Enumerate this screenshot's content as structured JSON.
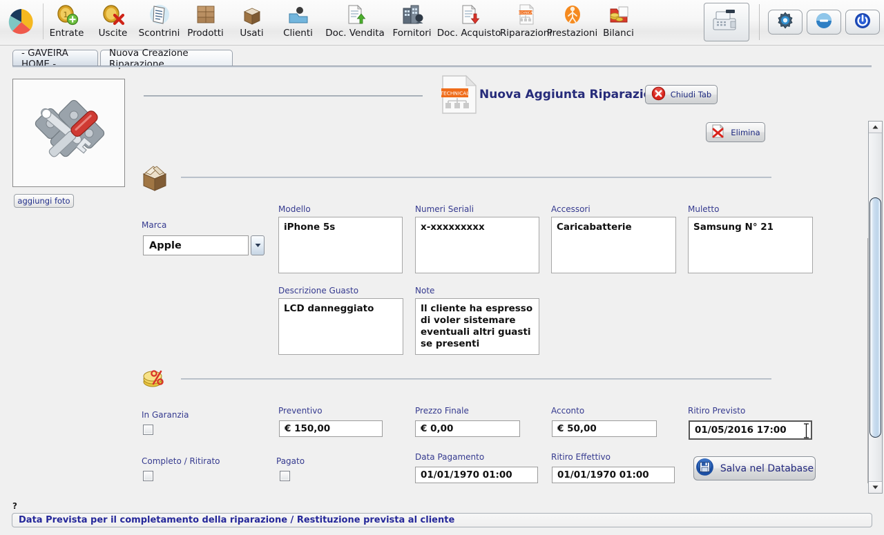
{
  "toolbar": {
    "logo": "pie-chart-logo",
    "items": [
      {
        "label": "Entrate",
        "icon": "coin-add-icon"
      },
      {
        "label": "Uscite",
        "icon": "coin-delete-icon"
      },
      {
        "label": "Scontrini",
        "icon": "receipt-icon"
      },
      {
        "label": "Prodotti",
        "icon": "boxes-stack-icon"
      },
      {
        "label": "Usati",
        "icon": "open-box-icon"
      },
      {
        "label": "Clienti",
        "icon": "clients-folder-icon"
      },
      {
        "label": "Doc. Vendita",
        "icon": "document-up-icon"
      },
      {
        "label": "Fornitori",
        "icon": "suppliers-icon"
      },
      {
        "label": "Doc. Acquisto",
        "icon": "document-down-icon"
      },
      {
        "label": "Riparazioni",
        "icon": "technical-document-icon"
      },
      {
        "label": "Prestazioni",
        "icon": "orange-person-icon"
      },
      {
        "label": "Bilanci",
        "icon": "money-folder-icon"
      }
    ],
    "right_buttons": [
      {
        "name": "cash-register-button",
        "icon": "cash-register-icon"
      },
      {
        "name": "settings-button",
        "icon": "gear-icon"
      },
      {
        "name": "minimize-button",
        "icon": "minimize-icon"
      },
      {
        "name": "power-button",
        "icon": "power-icon"
      }
    ]
  },
  "tabs": [
    {
      "label": "- GAVEIRA HOME -",
      "active": false
    },
    {
      "label": "Nuova Creazione Riparazione",
      "active": true
    }
  ],
  "header": {
    "title": "Nuova Aggiunta Riparazione",
    "doc_icon": "technical-document-icon",
    "close_tab_label": "Chiudi Tab",
    "close_tab_icon": "red-x-circle-icon",
    "delete_label": "Elimina",
    "delete_icon": "page-delete-icon"
  },
  "photo": {
    "image_icon": "wrench-screwdriver-tools-icon",
    "add_photo_label": "aggiungi foto"
  },
  "device_section": {
    "icon": "open-box-icon",
    "marca": {
      "label": "Marca",
      "value": "Apple"
    },
    "modello": {
      "label": "Modello",
      "value": "iPhone 5s"
    },
    "seriali": {
      "label": "Numeri Seriali",
      "value": "x-xxxxxxxxx"
    },
    "accessori": {
      "label": "Accessori",
      "value": "Caricabatterie"
    },
    "muletto": {
      "label": "Muletto",
      "value": "Samsung N° 21"
    },
    "descrizione": {
      "label": "Descrizione Guasto",
      "value": "LCD danneggiato"
    },
    "note": {
      "label": "Note",
      "value": "Il cliente ha espresso di voler sistemare eventuali altri guasti se presenti"
    }
  },
  "payment_section": {
    "icon": "coins-percent-icon",
    "in_garanzia": {
      "label": "In Garanzia",
      "checked": false
    },
    "completo_ritirato": {
      "label": "Completo / Ritirato",
      "checked": false
    },
    "pagato": {
      "label": "Pagato",
      "checked": false
    },
    "preventivo": {
      "label": "Preventivo",
      "value": "€ 150,00"
    },
    "prezzo_finale": {
      "label": "Prezzo Finale",
      "value": "€ 0,00"
    },
    "acconto": {
      "label": "Acconto",
      "value": "€ 50,00"
    },
    "ritiro_previsto": {
      "label": "Ritiro Previsto",
      "value": "01/05/2016 17:00",
      "focused": true
    },
    "data_pagamento": {
      "label": "Data Pagamento",
      "value": "01/01/1970 01:00"
    },
    "ritiro_effettivo": {
      "label": "Ritiro Effettivo",
      "value": "01/01/1970 01:00"
    },
    "save_label": "Salva nel Database",
    "save_icon": "floppy-disk-icon"
  },
  "status": {
    "help_marker": "?",
    "message": "Data Prevista per il completamento della riparazione / Restituzione prevista al cliente"
  }
}
